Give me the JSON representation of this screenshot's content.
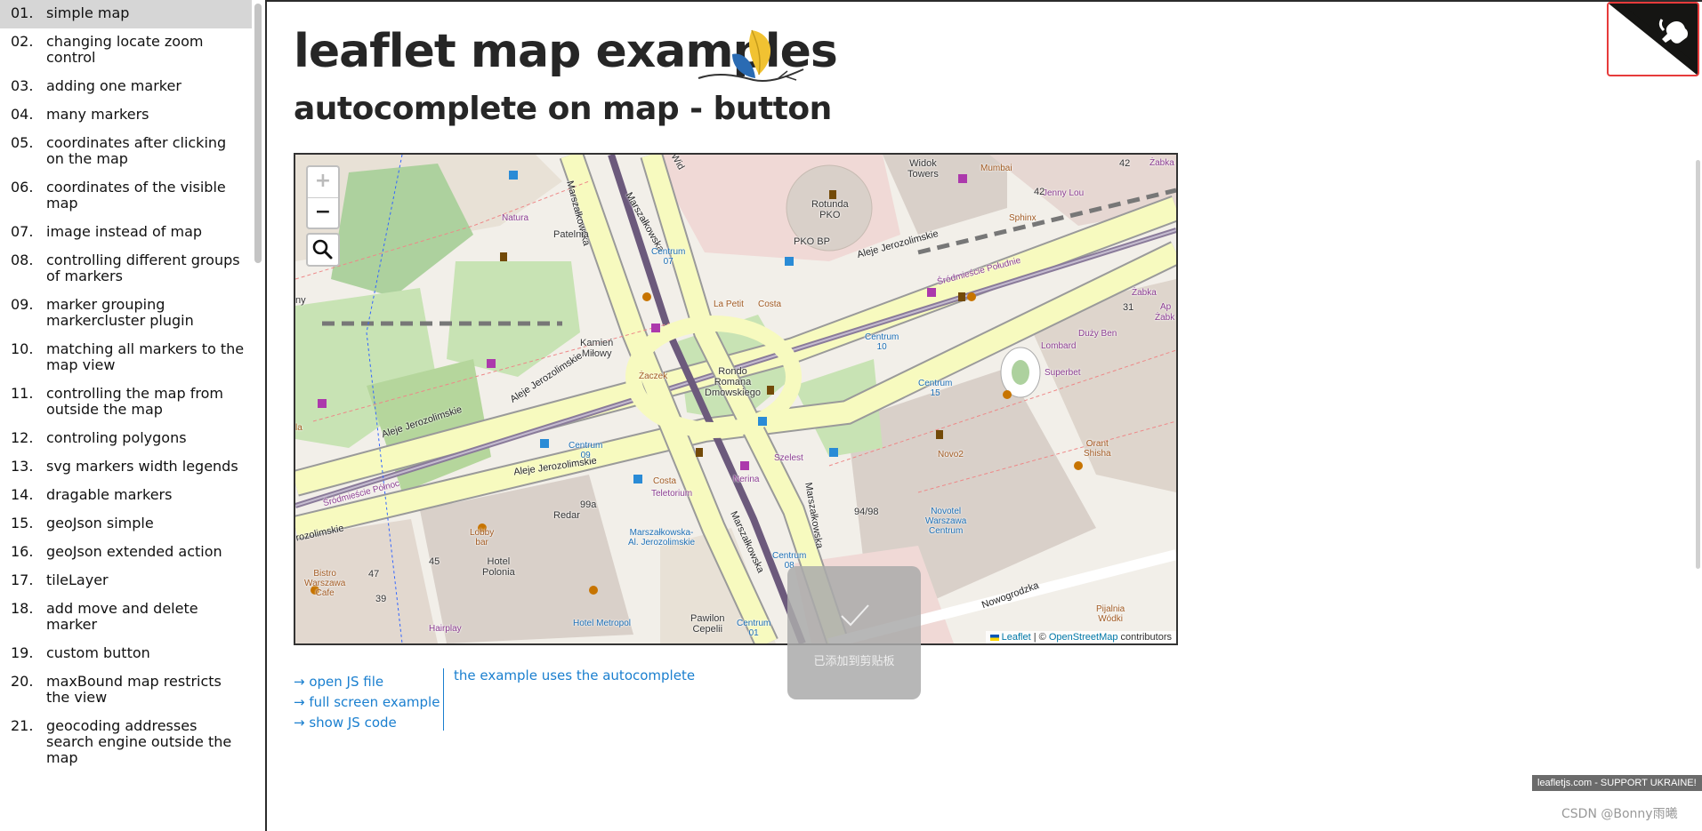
{
  "sidebar": {
    "items": [
      {
        "num": "01.",
        "label": "simple map"
      },
      {
        "num": "02.",
        "label": "changing locate zoom control"
      },
      {
        "num": "03.",
        "label": "adding one marker"
      },
      {
        "num": "04.",
        "label": "many markers"
      },
      {
        "num": "05.",
        "label": "coordinates after clicking on the map"
      },
      {
        "num": "06.",
        "label": "coordinates of the visible map"
      },
      {
        "num": "07.",
        "label": "image instead of map"
      },
      {
        "num": "08.",
        "label": "controlling different groups of markers"
      },
      {
        "num": "09.",
        "label": "marker grouping markercluster plugin"
      },
      {
        "num": "10.",
        "label": "matching all markers to the map view"
      },
      {
        "num": "11.",
        "label": "controlling the map from outside the map"
      },
      {
        "num": "12.",
        "label": "controling polygons"
      },
      {
        "num": "13.",
        "label": "svg markers width legends"
      },
      {
        "num": "14.",
        "label": "dragable markers"
      },
      {
        "num": "15.",
        "label": "geoJson simple"
      },
      {
        "num": "16.",
        "label": "geoJson extended action"
      },
      {
        "num": "17.",
        "label": "tileLayer"
      },
      {
        "num": "18.",
        "label": "add move and delete marker"
      },
      {
        "num": "19.",
        "label": "custom button"
      },
      {
        "num": "20.",
        "label": "maxBound map restricts the view"
      },
      {
        "num": "21.",
        "label": "geocoding addresses search engine outside the map"
      }
    ],
    "active_index": 0
  },
  "header": {
    "title": "leaflet map examples",
    "subtitle": "autocomplete on map - button"
  },
  "map": {
    "zoom_in": "+",
    "zoom_out": "−",
    "search_icon": "search-icon",
    "attribution": {
      "leaflet": "Leaflet",
      "sep": " | © ",
      "osm": "OpenStreetMap",
      "contributors": " contributors"
    },
    "labels": {
      "aleje1": "Aleje Jerozolimskie",
      "aleje2": "Aleje Jerozolimskie",
      "aleje3": "Aleje Jerozolimskie",
      "aleje4": "Aleje Jerozolimskie",
      "aleje5": "rozolimskie",
      "marsz1": "Marszałkowska",
      "marsz2": "Marszałkowska",
      "marsz3": "Marszałkowska",
      "marsz4": "Marszałkowska",
      "nowogrodzka": "Nowogrodzka",
      "rondo": "Rondo\nRomana\nDmowskiego",
      "rotunda": "Rotunda\nPKO",
      "pkobp": "PKO BP",
      "widok": "Widok\nTowers",
      "mumbai": "Mumbai",
      "jennylou": "Jenny Lou",
      "sphinx": "Sphinx",
      "natura": "Natura",
      "patelnia": "Patelnia",
      "centrum07": "Centrum\n07",
      "centrum10": "Centrum\n10",
      "centrum15": "Centrum\n15",
      "centrum09": "Centrum\n09",
      "centrum08": "Centrum\n08",
      "centrum01": "Centrum\n01",
      "kamien": "Kamień\nMiłowy",
      "zaczek": "Żaczek",
      "lapetit": "La Petit",
      "costa1": "Costa",
      "costa2": "Costa",
      "nerina": "Nerina",
      "teletorium": "Teletorium",
      "szelest": "Szelest",
      "superbet": "Superbet",
      "duzyben": "Duży Ben",
      "lombard": "Lombard",
      "zabka1": "Żabka",
      "zabka2": "Żabka",
      "orantshisha": "Orant\nShisha",
      "novo2": "Novo2",
      "novotel": "Novotel\nWarszawa\nCentrum",
      "redar": "Redar",
      "lobbybar": "Lobby\nbar",
      "hotelpolonia": "Hotel\nPolonia",
      "hotelmetropol": "Hotel Metropol",
      "marszal": "Marszałkowska-\nAl. Jerozolimskie",
      "pawilon": "Pawilon\nCepelii",
      "bistro": "Bistro\nWarszawa\nCafe",
      "hairplay": "Hairplay",
      "pijalnia": "Pijalnia\nWódki",
      "srod1": "Śródmieście Północ",
      "srod2": "Śródmieście Południe",
      "n9498": "94/98",
      "n99a": "99a",
      "n45": "45",
      "n47": "47",
      "n39": "39",
      "n42a": "42",
      "n42b": "42",
      "n31": "31",
      "nny": "ny",
      "nla": "la",
      "nap": "Ap",
      "zabk": "Żabk",
      "widk": "Wid"
    }
  },
  "links": {
    "open_js": "→ open JS file",
    "full_screen": "→ full screen example",
    "show_js": "→ show JS code",
    "note": "the example uses the autocomplete"
  },
  "toast": {
    "message": "已添加到剪贴板",
    "icon": "check-icon"
  },
  "github_corner": {
    "icon": "github-octocat-icon"
  },
  "footer": {
    "ukraine": "leafletjs.com - SUPPORT UKRAINE!",
    "watermark": "CSDN @Bonny雨曦"
  },
  "colors": {
    "link": "#1a7fcf",
    "active_item": "#d6d6d6",
    "major_road": "#f7fabf",
    "highlight_border": "#e63b3b"
  }
}
